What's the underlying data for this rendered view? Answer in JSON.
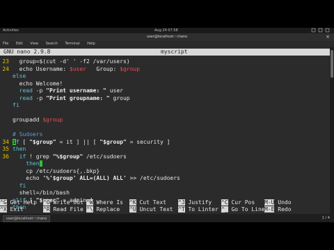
{
  "topbar": {
    "activities": "Activities",
    "clock": "Aug 24 07:58"
  },
  "window": {
    "title": "user@localhost:~/nano",
    "close": "×"
  },
  "menu": [
    "File",
    "Edit",
    "View",
    "Search",
    "Terminal",
    "Help"
  ],
  "nano": {
    "version": "GNU nano 2.9.8",
    "filename": "myscript"
  },
  "lines": [
    {
      "n": "23",
      "html": "  group=$(cut -d' ' -f2 /var/users)"
    },
    {
      "n": "24",
      "html": "  echo Username: <span class=\"red\">$user</span>   Group: <span class=\"red\">$group</span>"
    },
    {
      "n": "",
      "html": "<span class=\"kw\">else</span>"
    },
    {
      "n": "",
      "html": "  echo Welcome!"
    },
    {
      "n": "",
      "html": "  <span class=\"kw\">read</span> -p <span class=\"str\">\"Print username: \"</span> user"
    },
    {
      "n": "",
      "html": "  <span class=\"kw\">read</span> -p <span class=\"str\">\"Print groupname: \"</span> group"
    },
    {
      "n": "",
      "html": "<span class=\"kw\">fi</span>"
    },
    {
      "n": "",
      "html": ""
    },
    {
      "n": "",
      "html": "groupadd <span class=\"red\">$group</span>"
    },
    {
      "n": "",
      "html": ""
    },
    {
      "n": "",
      "html": "<span class=\"cm\"># Sudoers</span>"
    },
    {
      "n": "34",
      "html": "<span class=\"cursor\">i</span><span class=\"kw\">f</span> [ <span class=\"str\">\"$group\"</span> = it ] || [ <span class=\"str\">\"$group\"</span> = security ]"
    },
    {
      "n": "35",
      "html": "<span class=\"kw\">then</span>"
    },
    {
      "n": "36",
      "html": "  <span class=\"kw\">if</span> ! grep <span class=\"str\">\"%$group\"</span> /etc/sudoers"
    },
    {
      "n": "",
      "html": "    <span class=\"kw\">then</span><span class=\"cursor\"> </span>"
    },
    {
      "n": "",
      "html": "    cp /etc/sudoers{,.bkp}"
    },
    {
      "n": "",
      "html": "    echo <span class=\"str\">'%'$group' ALL=(ALL) ALL'</span> >> /etc/sudoers"
    },
    {
      "n": "",
      "html": "  <span class=\"kw\">fi</span>"
    },
    {
      "n": "",
      "html": "  shell=/bin/bash"
    },
    {
      "n": "",
      "html": "<span class=\"kw\">elif</span> [ <span class=\"str\">\"$user\"</span> = admin ]"
    },
    {
      "n": "",
      "html": "<span class=\"kw\">then</span>"
    }
  ],
  "shortcuts": [
    {
      "key": "^G",
      "label": "Get Help"
    },
    {
      "key": "^O",
      "label": "Write Out"
    },
    {
      "key": "^W",
      "label": "Where Is"
    },
    {
      "key": "^K",
      "label": "Cut Text"
    },
    {
      "key": "^J",
      "label": "Justify"
    },
    {
      "key": "^C",
      "label": "Cur Pos"
    },
    {
      "key": "M-U",
      "label": "Undo"
    },
    {
      "key": "^X",
      "label": "Exit"
    },
    {
      "key": "^R",
      "label": "Read File"
    },
    {
      "key": "^\\",
      "label": "Replace"
    },
    {
      "key": "^U",
      "label": "Uncut Text"
    },
    {
      "key": "^T",
      "label": "To Linter"
    },
    {
      "key": "^_",
      "label": "Go To Line"
    },
    {
      "key": "M-E",
      "label": "Redo"
    }
  ],
  "taskbar": {
    "item": "user@localhost:~/nano",
    "pager": "1 / 4"
  }
}
